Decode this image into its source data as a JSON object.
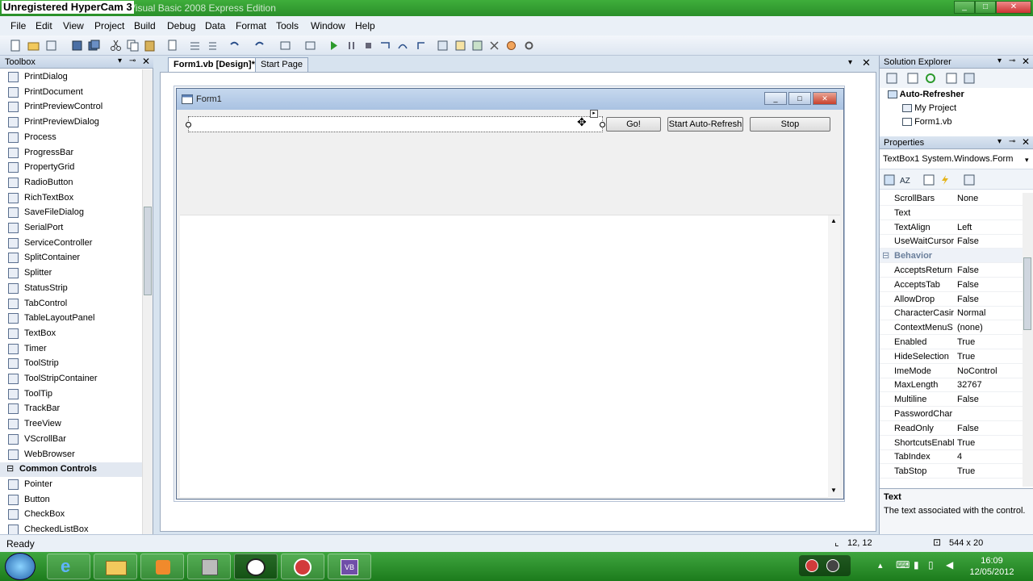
{
  "window": {
    "watermark": "Unregistered HyperCam 3",
    "title": "Visual Basic 2008 Express Edition",
    "controls": [
      "_",
      "□",
      "✕"
    ]
  },
  "menu": [
    "File",
    "Edit",
    "View",
    "Project",
    "Build",
    "Debug",
    "Data",
    "Format",
    "Tools",
    "Window",
    "Help"
  ],
  "toolbox": {
    "title": "Toolbox",
    "items": [
      {
        "label": "PrintDialog",
        "icon": "print-dialog-icon"
      },
      {
        "label": "PrintDocument",
        "icon": "print-document-icon"
      },
      {
        "label": "PrintPreviewControl",
        "icon": "print-preview-control-icon"
      },
      {
        "label": "PrintPreviewDialog",
        "icon": "print-preview-dialog-icon"
      },
      {
        "label": "Process",
        "icon": "process-icon"
      },
      {
        "label": "ProgressBar",
        "icon": "progress-bar-icon"
      },
      {
        "label": "PropertyGrid",
        "icon": "property-grid-icon"
      },
      {
        "label": "RadioButton",
        "icon": "radio-button-icon"
      },
      {
        "label": "RichTextBox",
        "icon": "rich-text-box-icon"
      },
      {
        "label": "SaveFileDialog",
        "icon": "save-file-dialog-icon"
      },
      {
        "label": "SerialPort",
        "icon": "serial-port-icon"
      },
      {
        "label": "ServiceController",
        "icon": "service-controller-icon"
      },
      {
        "label": "SplitContainer",
        "icon": "split-container-icon"
      },
      {
        "label": "Splitter",
        "icon": "splitter-icon"
      },
      {
        "label": "StatusStrip",
        "icon": "status-strip-icon"
      },
      {
        "label": "TabControl",
        "icon": "tab-control-icon"
      },
      {
        "label": "TableLayoutPanel",
        "icon": "table-layout-panel-icon"
      },
      {
        "label": "TextBox",
        "icon": "text-box-icon"
      },
      {
        "label": "Timer",
        "icon": "timer-icon"
      },
      {
        "label": "ToolStrip",
        "icon": "tool-strip-icon"
      },
      {
        "label": "ToolStripContainer",
        "icon": "tool-strip-container-icon"
      },
      {
        "label": "ToolTip",
        "icon": "tool-tip-icon"
      },
      {
        "label": "TrackBar",
        "icon": "track-bar-icon"
      },
      {
        "label": "TreeView",
        "icon": "tree-view-icon"
      },
      {
        "label": "VScrollBar",
        "icon": "vscroll-bar-icon"
      },
      {
        "label": "WebBrowser",
        "icon": "web-browser-icon"
      }
    ],
    "category": "Common Controls",
    "common": [
      {
        "label": "Pointer",
        "icon": "pointer-icon"
      },
      {
        "label": "Button",
        "icon": "button-icon"
      },
      {
        "label": "CheckBox",
        "icon": "check-box-icon"
      },
      {
        "label": "CheckedListBox",
        "icon": "checked-list-box-icon"
      }
    ]
  },
  "tabs": {
    "active": "Form1.vb [Design]*",
    "other": "Start Page"
  },
  "form": {
    "title": "Form1",
    "go": "Go!",
    "start": "Start Auto-Refresh",
    "stop": "Stop"
  },
  "solution": {
    "title": "Solution Explorer",
    "project": "Auto-Refresher",
    "my_project": "My Project",
    "file": "Form1.vb"
  },
  "properties": {
    "title": "Properties",
    "object": "TextBox1 System.Windows.Form",
    "rows": [
      {
        "name": "ScrollBars",
        "value": "None"
      },
      {
        "name": "Text",
        "value": ""
      },
      {
        "name": "TextAlign",
        "value": "Left"
      },
      {
        "name": "UseWaitCursor",
        "value": "False"
      },
      {
        "name": "Behavior",
        "value": "",
        "category": true
      },
      {
        "name": "AcceptsReturn",
        "value": "False"
      },
      {
        "name": "AcceptsTab",
        "value": "False"
      },
      {
        "name": "AllowDrop",
        "value": "False"
      },
      {
        "name": "CharacterCasir",
        "value": "Normal"
      },
      {
        "name": "ContextMenuS",
        "value": "(none)"
      },
      {
        "name": "Enabled",
        "value": "True"
      },
      {
        "name": "HideSelection",
        "value": "True"
      },
      {
        "name": "ImeMode",
        "value": "NoControl"
      },
      {
        "name": "MaxLength",
        "value": "32767"
      },
      {
        "name": "Multiline",
        "value": "False"
      },
      {
        "name": "PasswordChar",
        "value": ""
      },
      {
        "name": "ReadOnly",
        "value": "False"
      },
      {
        "name": "ShortcutsEnabl",
        "value": "True"
      },
      {
        "name": "TabIndex",
        "value": "4"
      },
      {
        "name": "TabStop",
        "value": "True"
      }
    ],
    "desc_title": "Text",
    "desc_text": "The text associated with the control."
  },
  "status": {
    "text": "Ready",
    "position": "12, 12",
    "size": "544 x 20"
  },
  "clock": {
    "time": "16:09",
    "date": "12/05/2012"
  },
  "colors": {
    "taskbar": "#2a8f2a",
    "accent": "#3fae3b"
  }
}
